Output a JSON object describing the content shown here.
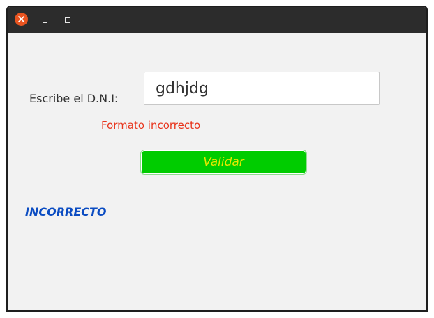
{
  "window": {
    "controls": {
      "close_icon": "close-icon",
      "minimize_icon": "minimize-icon",
      "maximize_icon": "maximize-icon"
    }
  },
  "form": {
    "dni_label": "Escribe el D.N.I:",
    "dni_value": "gdhjdg",
    "error_text": "Formato incorrecto",
    "validate_label": "Validar",
    "result_text": "INCORRECTO"
  },
  "colors": {
    "titlebar": "#2c2c2c",
    "close_button": "#e95420",
    "error_text": "#e8341c",
    "validate_button_bg": "#00cc00",
    "validate_button_text": "#e8e800",
    "result_text": "#0b4cc2"
  }
}
